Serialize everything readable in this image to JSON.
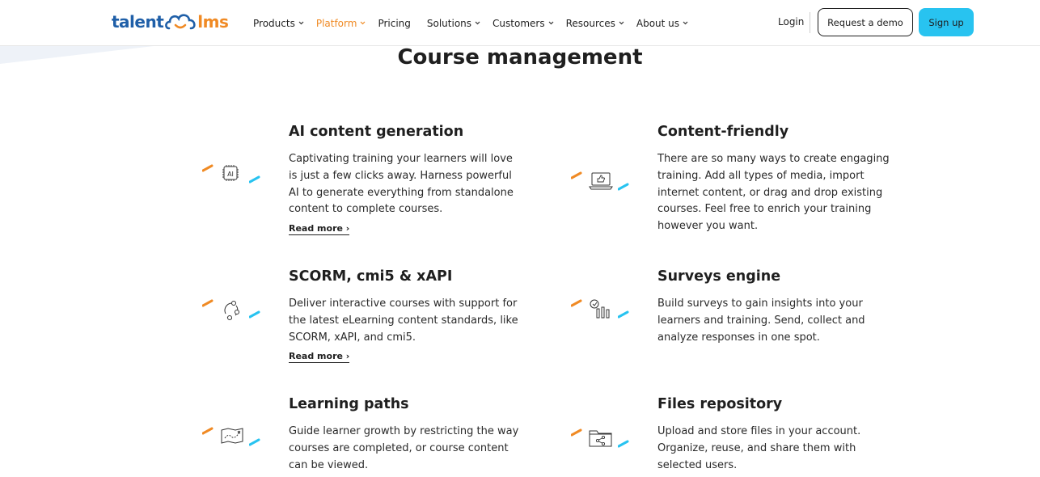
{
  "header": {
    "logo": {
      "part1": "talent",
      "part2": "lms"
    },
    "nav": [
      {
        "label": "Products",
        "active": false
      },
      {
        "label": "Platform",
        "active": true
      },
      {
        "label": "Pricing",
        "active": false,
        "no_chevron": true
      },
      {
        "label": "Solutions",
        "active": false
      },
      {
        "label": "Customers",
        "active": false
      },
      {
        "label": "Resources",
        "active": false
      },
      {
        "label": "About us",
        "active": false
      }
    ],
    "login": "Login",
    "request_demo": "Request a demo",
    "sign_up": "Sign up"
  },
  "main": {
    "title": "Course management",
    "features": [
      {
        "icon": "ai-chip-icon",
        "title": "AI content generation",
        "text": "Captivating training your learners will love is just a few clicks away. Harness powerful AI to generate everything from standalone content to complete courses.",
        "read_more": "Read more ›"
      },
      {
        "icon": "laptop-thumbs-up-icon",
        "title": "Content-friendly",
        "text": "There are so many ways to create engaging training. Add all types of media, import internet content, or drag and drop existing courses. Feel free to enrich your training however you want.",
        "read_more": ""
      },
      {
        "icon": "cycle-nodes-icon",
        "title": "SCORM, cmi5 & xAPI",
        "text": "Deliver interactive courses with support for the latest eLearning content standards, like SCORM, xAPI, and cmi5.",
        "read_more": "Read more ›"
      },
      {
        "icon": "survey-chart-icon",
        "title": "Surveys engine",
        "text": "Build surveys to gain insights into your learners and training. Send, collect and analyze responses in one spot.",
        "read_more": ""
      },
      {
        "icon": "map-path-icon",
        "title": "Learning paths",
        "text": "Guide learner growth by restricting the way courses are completed, or course content can be viewed.",
        "read_more": ""
      },
      {
        "icon": "folder-share-icon",
        "title": "Files repository",
        "text": "Upload and store files in your account. Organize, reuse, and share them with selected users.",
        "read_more": ""
      }
    ]
  },
  "colors": {
    "brand_blue": "#1f5fa8",
    "brand_orange": "#f08a24",
    "cta_cyan": "#28c3f0",
    "accent_dash_blue": "#28c3f0"
  }
}
